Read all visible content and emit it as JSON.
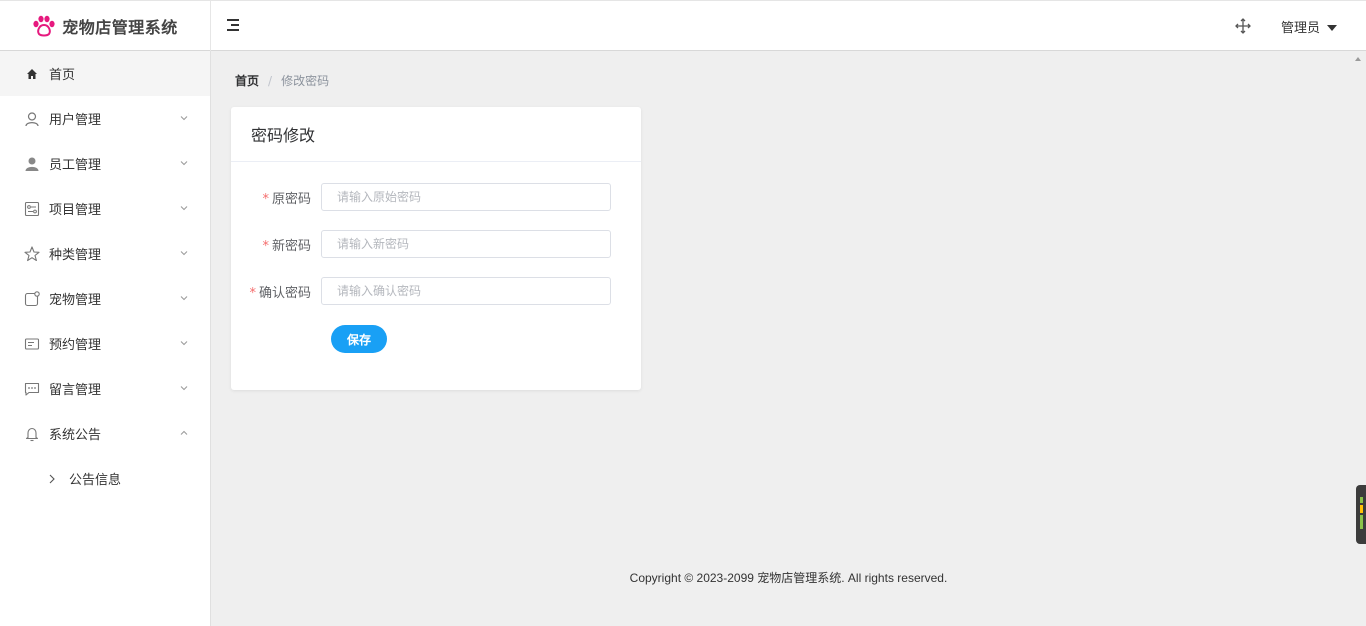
{
  "header": {
    "app_title": "宠物店管理系统",
    "user_label": "管理员"
  },
  "sidebar": {
    "items": [
      {
        "label": "首页"
      },
      {
        "label": "用户管理"
      },
      {
        "label": "员工管理"
      },
      {
        "label": "项目管理"
      },
      {
        "label": "种类管理"
      },
      {
        "label": "宠物管理"
      },
      {
        "label": "预约管理"
      },
      {
        "label": "留言管理"
      },
      {
        "label": "系统公告"
      }
    ],
    "sub_items": [
      {
        "label": "公告信息"
      }
    ]
  },
  "breadcrumb": {
    "home": "首页",
    "separator": "/",
    "current": "修改密码"
  },
  "card": {
    "title": "密码修改",
    "fields": [
      {
        "required_mark": "*",
        "label": "原密码",
        "placeholder": "请输入原始密码",
        "value": ""
      },
      {
        "required_mark": "*",
        "label": "新密码",
        "placeholder": "请输入新密码",
        "value": ""
      },
      {
        "required_mark": "*",
        "label": "确认密码",
        "placeholder": "请输入确认密码",
        "value": ""
      }
    ],
    "save_label": "保存"
  },
  "footer": {
    "text": "Copyright © 2023-2099 宠物店管理系统. All rights reserved."
  },
  "colors": {
    "logo_accent": "#e6197e",
    "primary_button": "#19a0f5",
    "required_mark": "#f56c6c"
  }
}
